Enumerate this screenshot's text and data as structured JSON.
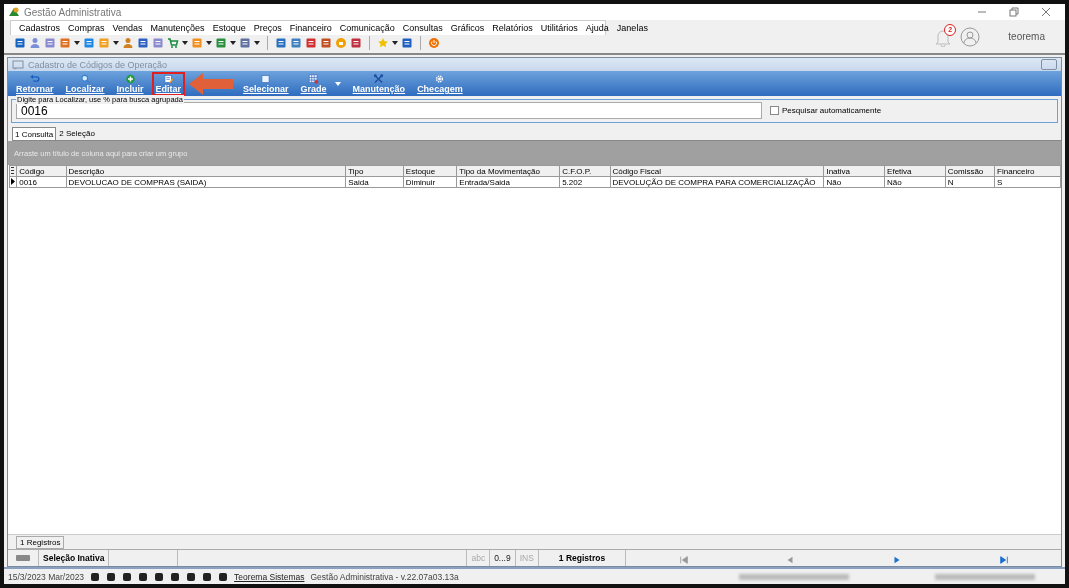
{
  "window": {
    "title": "Gestão Administrativa"
  },
  "menu": [
    "Cadastros",
    "Compras",
    "Vendas",
    "Manutenções",
    "Estoque",
    "Preços",
    "Financeiro",
    "Comunicação",
    "Consultas",
    "Gráficos",
    "Relatórios",
    "Utilitários",
    "Ajuda",
    "Janelas"
  ],
  "user": {
    "notifications": "2",
    "name": "teorema"
  },
  "form": {
    "title": "Cadastro de Códigos de Operação"
  },
  "ribbon": [
    {
      "label": "Retornar",
      "kind": "undo",
      "highlighted": false,
      "dropdown": false
    },
    {
      "label": "Localizar",
      "kind": "search",
      "highlighted": false,
      "dropdown": false
    },
    {
      "label": "Incluir",
      "kind": "add",
      "highlighted": false,
      "dropdown": false
    },
    {
      "label": "Editar",
      "kind": "edit",
      "highlighted": true,
      "dropdown": false
    },
    {
      "label": "Selecionar",
      "kind": "select",
      "highlighted": false,
      "dropdown": false
    },
    {
      "label": "Grade",
      "kind": "grid",
      "highlighted": false,
      "dropdown": true
    },
    {
      "label": "Manutenção",
      "kind": "tools",
      "highlighted": false,
      "dropdown": false
    },
    {
      "label": "Checagem",
      "kind": "gear",
      "highlighted": false,
      "dropdown": false
    }
  ],
  "search": {
    "label": "Digite para Localizar, use % para busca agrupada",
    "value": "0016",
    "auto_search": {
      "label": "Pesquisar automaticamente",
      "checked": false
    }
  },
  "tabs": [
    {
      "label": "1 Consulta",
      "selected": true
    },
    {
      "label": "2 Seleção",
      "selected": false
    }
  ],
  "group_hint": "Arraste um título de coluna aqui para criar um grupo",
  "table": {
    "columns": [
      "Código",
      "Descrição",
      "Tipo",
      "Estoque",
      "Tipo da Movimentação",
      "C.F.O.P.",
      "Código Fiscal",
      "Inativa",
      "Efetiva",
      "Comissão",
      "Financeiro"
    ],
    "rows": [
      {
        "current": true,
        "cells": [
          "0016",
          "DEVOLUCAO DE COMPRAS (SAIDA)",
          "Saida",
          "Diminuir",
          "Entrada/Saida",
          "5.202",
          "DEVOLUÇÃO DE COMPRA PARA COMERCIALIZAÇÃO",
          "Não",
          "Não",
          "N",
          "S"
        ]
      }
    ]
  },
  "footer_count": "1 Registros",
  "status": {
    "selection": "Seleção Inativa",
    "indicators": [
      {
        "label": "abc",
        "disabled": true
      },
      {
        "label": "0...9",
        "disabled": false
      },
      {
        "label": "INS",
        "disabled": true
      }
    ],
    "records": "1 Registros",
    "nav": [
      {
        "kind": "first",
        "disabled": true
      },
      {
        "kind": "prev",
        "disabled": true
      },
      {
        "kind": "next",
        "disabled": false
      },
      {
        "kind": "last",
        "disabled": false
      }
    ]
  },
  "bottom": {
    "date": "15/3/2023 Mar/2023",
    "link": "Teorema Sistemas",
    "version": "Gestão Administrativa - v.22.07a03.13a"
  }
}
